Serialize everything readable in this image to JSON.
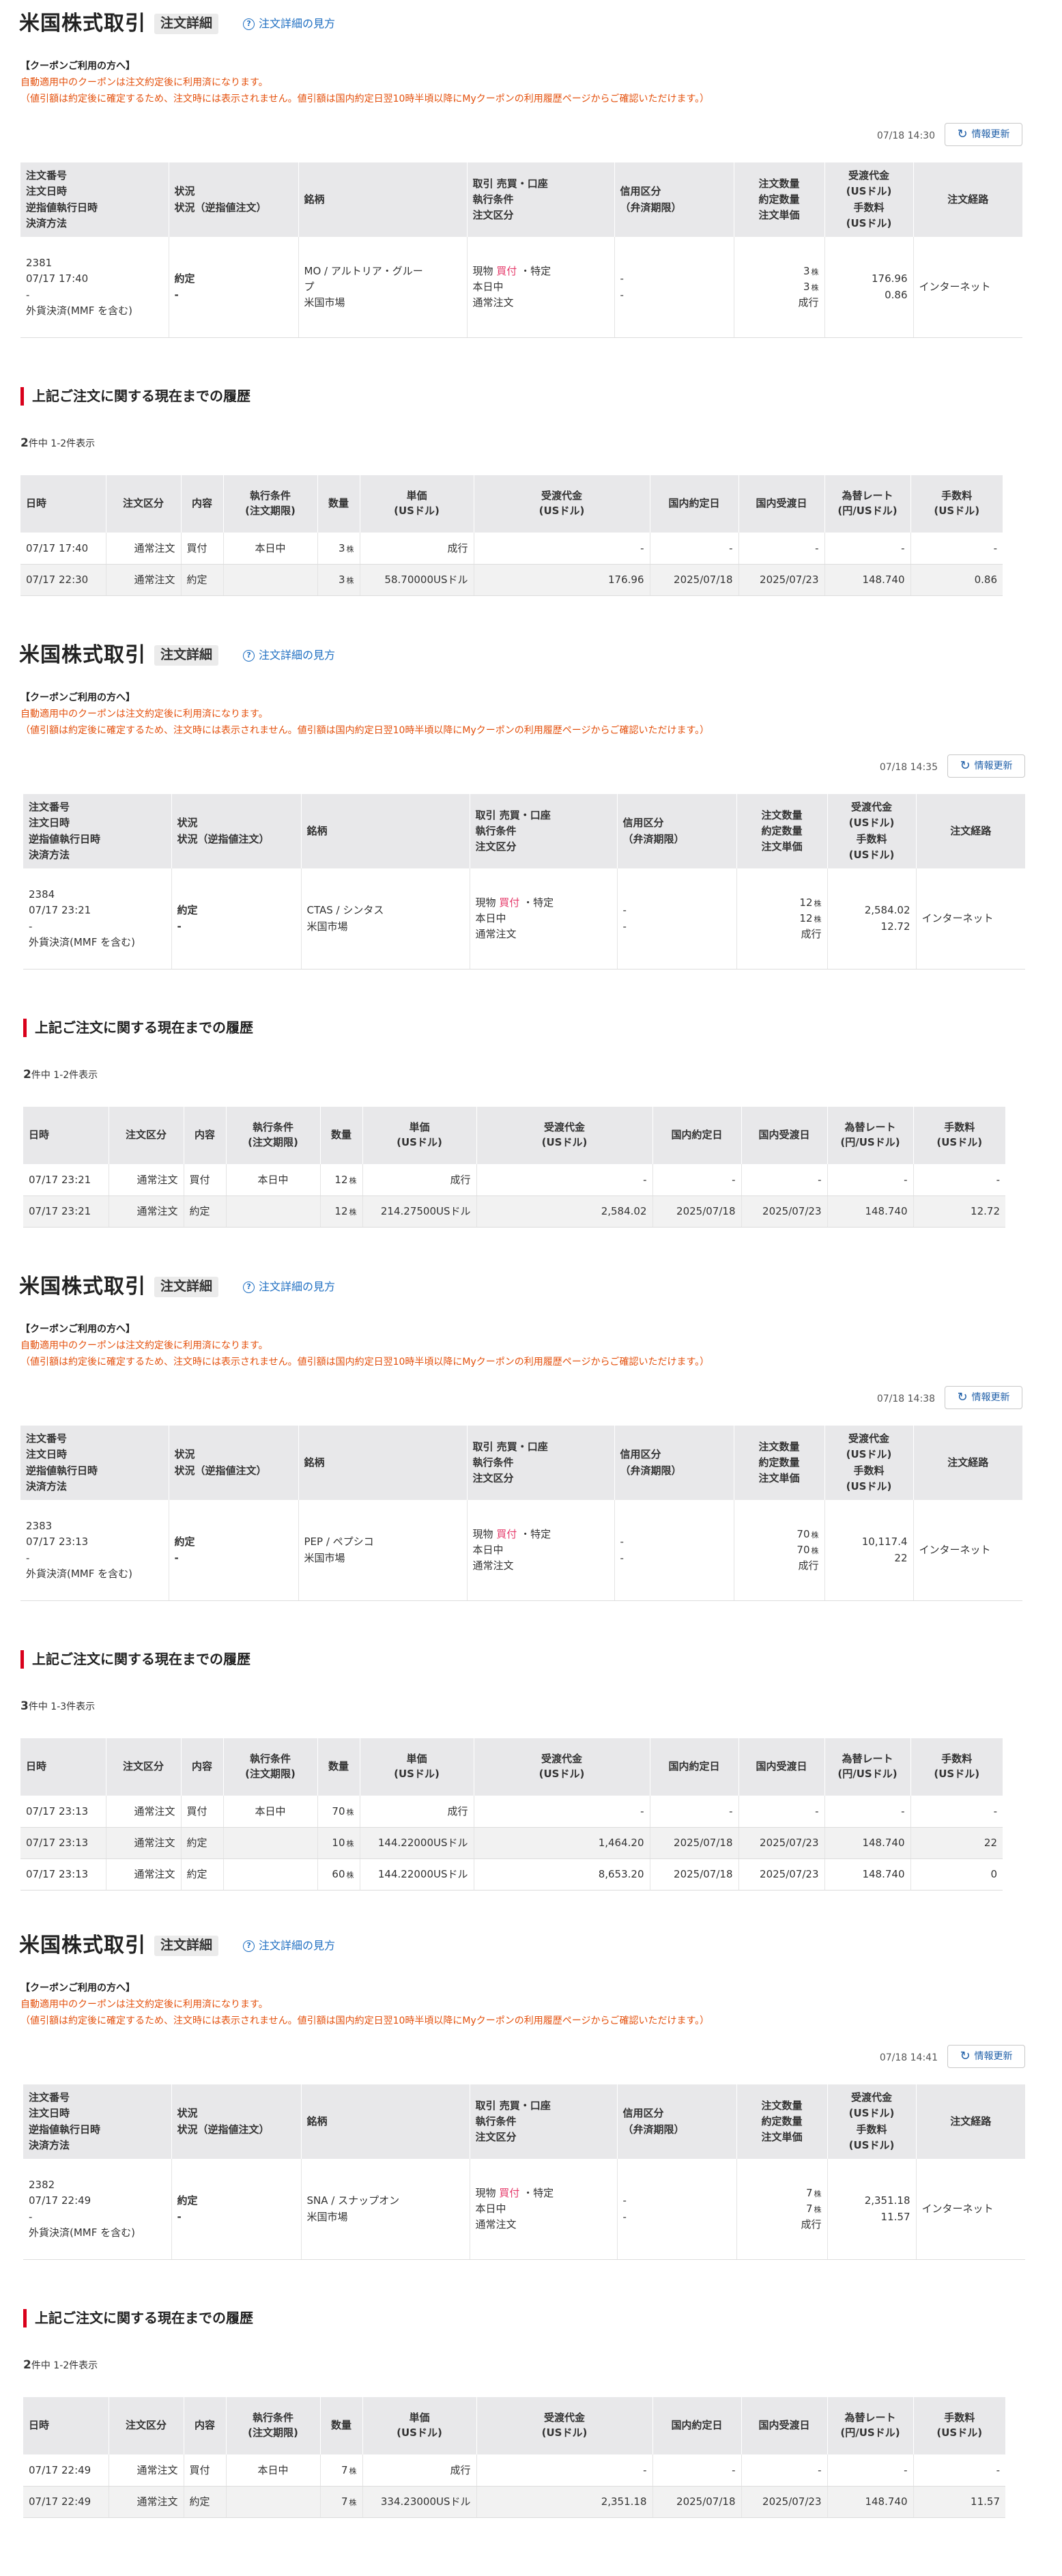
{
  "header": {
    "title": "米国株式取引",
    "subtitle": "注文詳細",
    "help_link": "注文詳細の見方",
    "help_icon": "question-circle-icon"
  },
  "coupon": {
    "title": "【クーポンご利用の方へ】",
    "line1": "自動適用中のクーポンは注文約定後に利用済になります。",
    "line2": "（値引額は約定後に確定するため、注文時には表示されません。値引額は国内約定日翌10時半頃以降にMyクーポンの利用履歴ページからご確認いただけます。）"
  },
  "refresh_label": "情報更新",
  "order_headers": {
    "col1": [
      "注文番号",
      "注文日時",
      "逆指値執行日時",
      "決済方法"
    ],
    "col2": [
      "状況",
      "状況（逆指値注文）"
    ],
    "col3": [
      "銘柄"
    ],
    "col4": [
      "取引 売買・口座",
      "執行条件",
      "注文区分"
    ],
    "col5": [
      "信用区分",
      "（弁済期限）"
    ],
    "col6": [
      "注文数量",
      "約定数量",
      "注文単価"
    ],
    "col7": [
      "受渡代金",
      "(USドル)",
      "手数料",
      "(USドル)"
    ],
    "col8": [
      "注文経路"
    ]
  },
  "history_title": "上記ご注文に関する現在までの履歴",
  "history_headers": [
    "日時",
    "注文区分",
    "内容",
    "執行条件\n(注文期限)",
    "数量",
    "単価\n(USドル)",
    "受渡代金\n(USドル)",
    "国内約定日",
    "国内受渡日",
    "為替レート\n(円/USドル)",
    "手数料\n(USドル)"
  ],
  "shares_unit": "株",
  "blocks": [
    {
      "timestamp": "07/18 14:30",
      "order": {
        "number": "2381",
        "datetime": "07/17 17:40",
        "stop_exec": "-",
        "settlement": "外貨決済(MMF を含む)",
        "status": "約定",
        "status_stop": "-",
        "stock_l1": "MO / アルトリア・グルー",
        "stock_l2": "プ",
        "market": "米国市場",
        "trade_pre": "現物",
        "trade_side": "買付",
        "trade_post": "・特定",
        "exec_cond": "本日中",
        "order_type": "通常注文",
        "credit1": "-",
        "credit2": "-",
        "qty_order": "3",
        "qty_exec": "3",
        "unit_price": "成行",
        "amount": "176.96",
        "fee": "0.86",
        "route": "インターネット"
      },
      "count_num": "2",
      "count_text": "件中 1-2件表示",
      "rows": [
        {
          "dt": "07/17 17:40",
          "type": "通常注文",
          "content": "買付",
          "cond": "本日中",
          "qty": "3",
          "price": "成行",
          "amount": "-",
          "exec_date": "-",
          "settle_date": "-",
          "rate": "-",
          "fee": "-"
        },
        {
          "dt": "07/17 22:30",
          "type": "通常注文",
          "content": "約定",
          "cond": "",
          "qty": "3",
          "price": "58.70000USドル",
          "amount": "176.96",
          "exec_date": "2025/07/18",
          "settle_date": "2025/07/23",
          "rate": "148.740",
          "fee": "0.86"
        }
      ]
    },
    {
      "timestamp": "07/18 14:35",
      "order": {
        "number": "2384",
        "datetime": "07/17 23:21",
        "stop_exec": "-",
        "settlement": "外貨決済(MMF を含む)",
        "status": "約定",
        "status_stop": "-",
        "stock_l1": "CTAS / シンタス",
        "stock_l2": "",
        "market": "米国市場",
        "trade_pre": "現物",
        "trade_side": "買付",
        "trade_post": "・特定",
        "exec_cond": "本日中",
        "order_type": "通常注文",
        "credit1": "-",
        "credit2": "-",
        "qty_order": "12",
        "qty_exec": "12",
        "unit_price": "成行",
        "amount": "2,584.02",
        "fee": "12.72",
        "route": "インターネット"
      },
      "count_num": "2",
      "count_text": "件中 1-2件表示",
      "rows": [
        {
          "dt": "07/17 23:21",
          "type": "通常注文",
          "content": "買付",
          "cond": "本日中",
          "qty": "12",
          "price": "成行",
          "amount": "-",
          "exec_date": "-",
          "settle_date": "-",
          "rate": "-",
          "fee": "-"
        },
        {
          "dt": "07/17 23:21",
          "type": "通常注文",
          "content": "約定",
          "cond": "",
          "qty": "12",
          "price": "214.27500USドル",
          "amount": "2,584.02",
          "exec_date": "2025/07/18",
          "settle_date": "2025/07/23",
          "rate": "148.740",
          "fee": "12.72"
        }
      ]
    },
    {
      "timestamp": "07/18 14:38",
      "order": {
        "number": "2383",
        "datetime": "07/17 23:13",
        "stop_exec": "-",
        "settlement": "外貨決済(MMF を含む)",
        "status": "約定",
        "status_stop": "-",
        "stock_l1": "PEP / ペプシコ",
        "stock_l2": "",
        "market": "米国市場",
        "trade_pre": "現物",
        "trade_side": "買付",
        "trade_post": "・特定",
        "exec_cond": "本日中",
        "order_type": "通常注文",
        "credit1": "-",
        "credit2": "-",
        "qty_order": "70",
        "qty_exec": "70",
        "unit_price": "成行",
        "amount": "10,117.4",
        "amount2": "22",
        "fee": "",
        "route": "インターネット"
      },
      "count_num": "3",
      "count_text": "件中 1-3件表示",
      "rows": [
        {
          "dt": "07/17 23:13",
          "type": "通常注文",
          "content": "買付",
          "cond": "本日中",
          "qty": "70",
          "price": "成行",
          "amount": "-",
          "exec_date": "-",
          "settle_date": "-",
          "rate": "-",
          "fee": "-"
        },
        {
          "dt": "07/17 23:13",
          "type": "通常注文",
          "content": "約定",
          "cond": "",
          "qty": "10",
          "price": "144.22000USドル",
          "amount": "1,464.20",
          "exec_date": "2025/07/18",
          "settle_date": "2025/07/23",
          "rate": "148.740",
          "fee": "22"
        },
        {
          "dt": "07/17 23:13",
          "type": "通常注文",
          "content": "約定",
          "cond": "",
          "qty": "60",
          "price": "144.22000USドル",
          "amount": "8,653.20",
          "exec_date": "2025/07/18",
          "settle_date": "2025/07/23",
          "rate": "148.740",
          "fee": "0"
        }
      ]
    },
    {
      "timestamp": "07/18 14:41",
      "order": {
        "number": "2382",
        "datetime": "07/17 22:49",
        "stop_exec": "-",
        "settlement": "外貨決済(MMF を含む)",
        "status": "約定",
        "status_stop": "-",
        "stock_l1": "SNA / スナップオン",
        "stock_l2": "",
        "market": "米国市場",
        "trade_pre": "現物",
        "trade_side": "買付",
        "trade_post": "・特定",
        "exec_cond": "本日中",
        "order_type": "通常注文",
        "credit1": "-",
        "credit2": "-",
        "qty_order": "7",
        "qty_exec": "7",
        "unit_price": "成行",
        "amount": "2,351.18",
        "fee": "11.57",
        "route": "インターネット"
      },
      "count_num": "2",
      "count_text": "件中 1-2件表示",
      "rows": [
        {
          "dt": "07/17 22:49",
          "type": "通常注文",
          "content": "買付",
          "cond": "本日中",
          "qty": "7",
          "price": "成行",
          "amount": "-",
          "exec_date": "-",
          "settle_date": "-",
          "rate": "-",
          "fee": "-"
        },
        {
          "dt": "07/17 22:49",
          "type": "通常注文",
          "content": "約定",
          "cond": "",
          "qty": "7",
          "price": "334.23000USドル",
          "amount": "2,351.18",
          "exec_date": "2025/07/18",
          "settle_date": "2025/07/23",
          "rate": "148.740",
          "fee": "11.57"
        }
      ]
    }
  ]
}
